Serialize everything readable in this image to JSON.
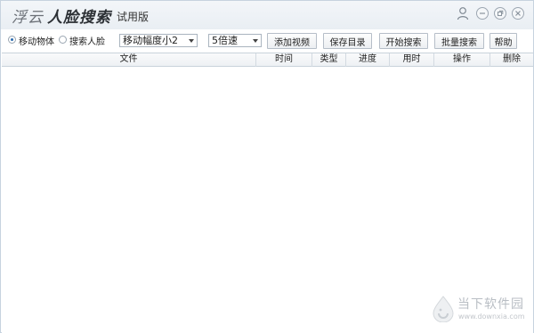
{
  "titlebar": {
    "brand_part1": "浮云",
    "brand_part2": "人脸搜索",
    "edition": "试用版",
    "icons": [
      "user-icon",
      "minimize-icon",
      "restore-icon",
      "close-icon"
    ]
  },
  "toolbar": {
    "mode_options": [
      {
        "label": "移动物体",
        "selected": true
      },
      {
        "label": "搜索人脸",
        "selected": false
      }
    ],
    "motion_select": {
      "value": "移动幅度小2"
    },
    "speed_select": {
      "value": "5倍速"
    },
    "buttons": {
      "add_video": "添加视频",
      "save_dir": "保存目录",
      "start_search": "开始搜索",
      "batch_search": "批量搜索",
      "help": "帮助"
    }
  },
  "table": {
    "columns": [
      "文件",
      "时间",
      "类型",
      "进度",
      "用时",
      "操作",
      "删除"
    ],
    "rows": []
  },
  "watermark": {
    "text": "当下软件园",
    "url": "www.downxia.com"
  },
  "colors": {
    "titlebar_bg": "#eef2f6",
    "border": "#c7d3df",
    "radio_accent": "#2b6cb0"
  }
}
